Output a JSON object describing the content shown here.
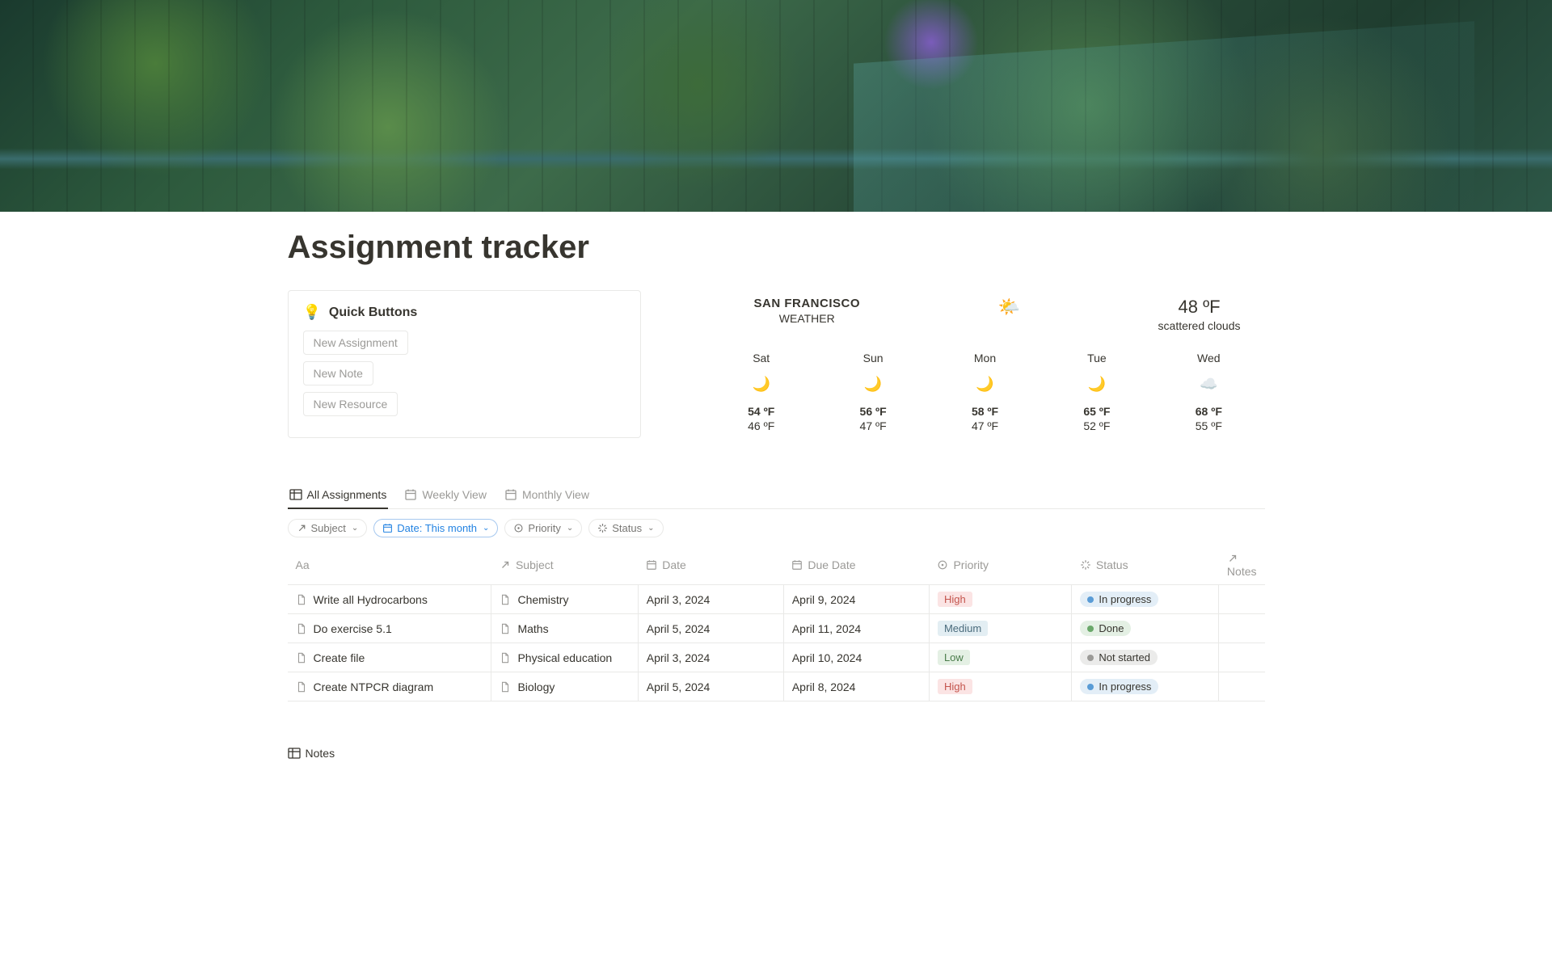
{
  "page": {
    "title": "Assignment tracker"
  },
  "quick": {
    "title": "Quick Buttons",
    "buttons": [
      "New Assignment",
      "New Note",
      "New Resource"
    ]
  },
  "weather": {
    "city": "SAN FRANCISCO",
    "sub": "WEATHER",
    "temp": "48 ºF",
    "condition": "scattered clouds",
    "forecast": [
      {
        "day": "Sat",
        "icon": "moon",
        "hi": "54 ºF",
        "lo": "46 ºF"
      },
      {
        "day": "Sun",
        "icon": "moon",
        "hi": "56 ºF",
        "lo": "47 ºF"
      },
      {
        "day": "Mon",
        "icon": "moon",
        "hi": "58 ºF",
        "lo": "47 ºF"
      },
      {
        "day": "Tue",
        "icon": "moon",
        "hi": "65 ºF",
        "lo": "52 ºF"
      },
      {
        "day": "Wed",
        "icon": "cloud",
        "hi": "68 ºF",
        "lo": "55 ºF"
      }
    ]
  },
  "tabs": [
    {
      "label": "All Assignments",
      "active": true,
      "icon": "table"
    },
    {
      "label": "Weekly View",
      "active": false,
      "icon": "calendar"
    },
    {
      "label": "Monthly View",
      "active": false,
      "icon": "calendar"
    }
  ],
  "filters": [
    {
      "label": "Subject",
      "icon": "arrow",
      "active": false
    },
    {
      "label": "Date: This month",
      "icon": "calendar",
      "active": true
    },
    {
      "label": "Priority",
      "icon": "circle",
      "active": false
    },
    {
      "label": "Status",
      "icon": "spinner",
      "active": false
    }
  ],
  "columns": [
    {
      "label": "Aa",
      "icon": ""
    },
    {
      "label": "Subject",
      "icon": "arrow"
    },
    {
      "label": "Date",
      "icon": "calendar"
    },
    {
      "label": "Due Date",
      "icon": "calendar"
    },
    {
      "label": "Priority",
      "icon": "circle"
    },
    {
      "label": "Status",
      "icon": "spinner"
    },
    {
      "label": "Notes",
      "icon": "arrow"
    }
  ],
  "rows": [
    {
      "name": "Write all Hydrocarbons",
      "subject": "Chemistry",
      "date": "April 3, 2024",
      "due": "April 9, 2024",
      "priority": "High",
      "status": "In progress"
    },
    {
      "name": "Do exercise 5.1",
      "subject": "Maths",
      "date": "April 5, 2024",
      "due": "April 11, 2024",
      "priority": "Medium",
      "status": "Done"
    },
    {
      "name": "Create file",
      "subject": "Physical education",
      "date": "April 3, 2024",
      "due": "April 10, 2024",
      "priority": "Low",
      "status": "Not started"
    },
    {
      "name": "Create NTPCR diagram",
      "subject": "Biology",
      "date": "April 5, 2024",
      "due": "April 8, 2024",
      "priority": "High",
      "status": "In progress"
    }
  ],
  "notesSection": {
    "label": "Notes"
  }
}
